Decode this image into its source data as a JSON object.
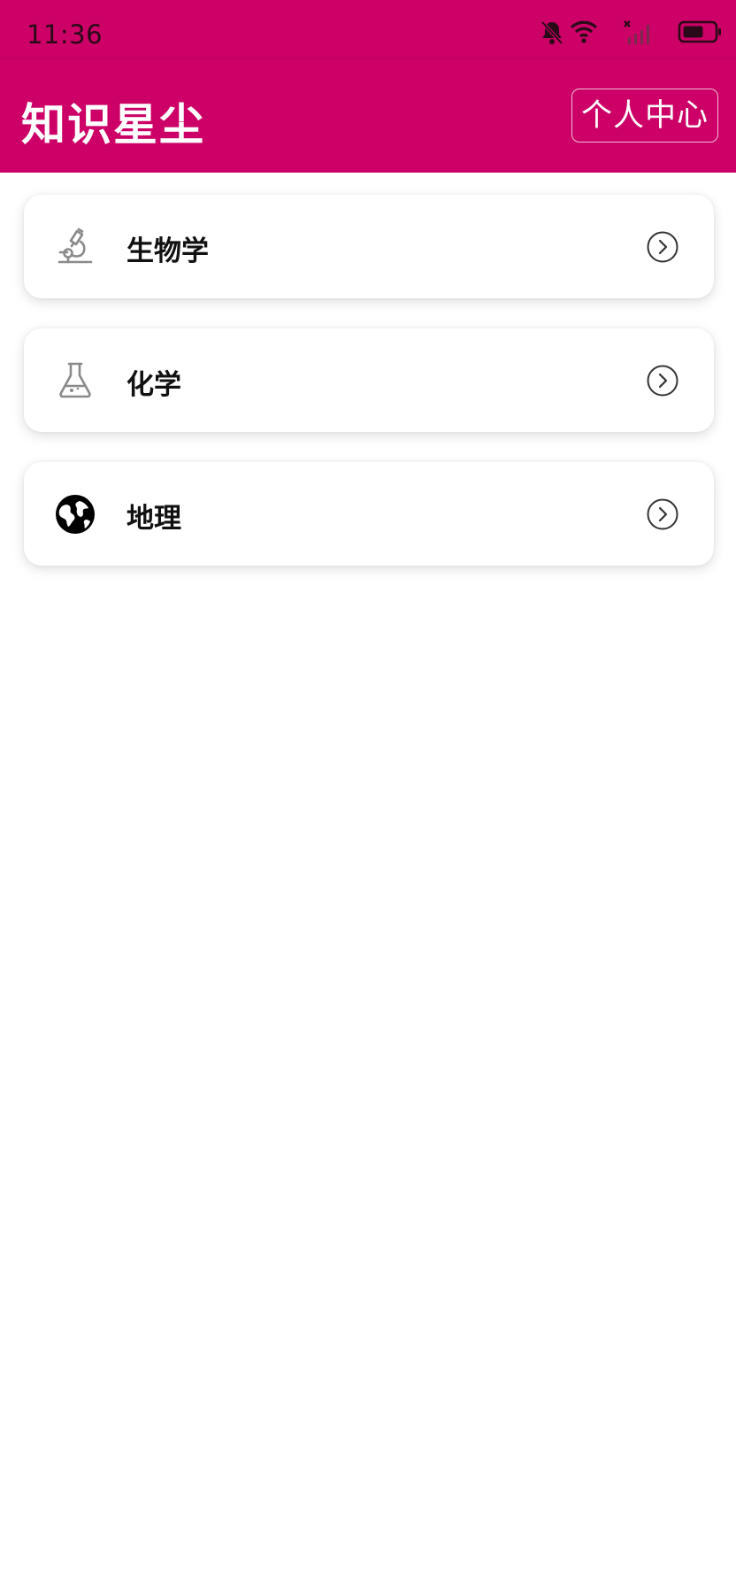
{
  "status_bar": {
    "time": "11:36",
    "icons": [
      "bell-muted-icon",
      "wifi-icon",
      "signal-icon",
      "battery-icon"
    ]
  },
  "header": {
    "title": "知识星尘",
    "profile_button_label": "个人中心"
  },
  "subjects": [
    {
      "label": "生物学",
      "icon": "microscope-icon",
      "chevron": "chevron-right-circle-icon"
    },
    {
      "label": "化学",
      "icon": "flask-icon",
      "chevron": "chevron-right-circle-icon"
    },
    {
      "label": "地理",
      "icon": "globe-icon",
      "chevron": "chevron-right-circle-icon"
    }
  ],
  "colors": {
    "brand": "#cc0066",
    "card_background": "#ffffff",
    "text_primary": "#111111"
  }
}
